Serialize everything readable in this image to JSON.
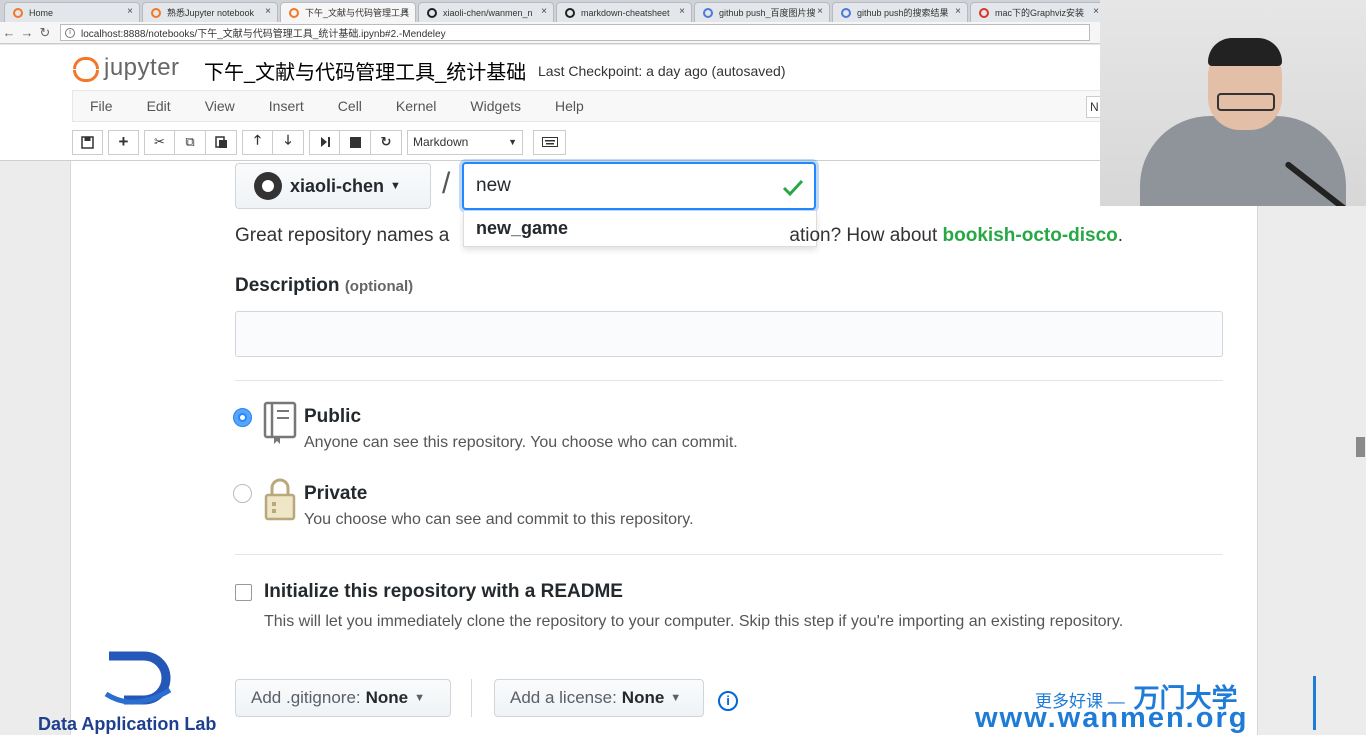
{
  "browser": {
    "tabs": [
      {
        "title": "Home",
        "color": "#f37726",
        "active": false
      },
      {
        "title": "熟悉Jupyter notebook",
        "color": "#f37726",
        "active": false
      },
      {
        "title": "下午_文献与代码管理工具",
        "color": "#f37726",
        "active": true
      },
      {
        "title": "xiaoli-chen/wanmen_n",
        "color": "#222222",
        "active": false
      },
      {
        "title": "markdown-cheatsheet",
        "color": "#222222",
        "active": false
      },
      {
        "title": "github push_百度图片搜",
        "color": "#4a7bd8",
        "active": false
      },
      {
        "title": "github push的搜索结果",
        "color": "#4a7bd8",
        "active": false
      },
      {
        "title": "mac下的Graphviz安装",
        "color": "#d9342b",
        "active": false
      }
    ],
    "url": "localhost:8888/notebooks/下午_文献与代码管理工具_统计基础.ipynb#2.-Mendeley"
  },
  "jupyter": {
    "logo_text": "jupyter",
    "notebook_title": "下午_文献与代码管理工具_统计基础",
    "checkpoint": "Last Checkpoint: a day ago (autosaved)",
    "menu": [
      "File",
      "Edit",
      "View",
      "Insert",
      "Cell",
      "Kernel",
      "Widgets",
      "Help"
    ],
    "menu_right": "N",
    "cell_type": "Markdown"
  },
  "github": {
    "owner": "xiaoli-chen",
    "repo_name": "new",
    "suggestion": "new_game",
    "great_names_start": "Great repository names a",
    "great_names_end": "ation? How about ",
    "suggested_name": "bookish-octo-disco",
    "description_label": "Description",
    "description_optional": "(optional)",
    "public_title": "Public",
    "public_desc": "Anyone can see this repository. You choose who can commit.",
    "private_title": "Private",
    "private_desc": "You choose who can see and commit to this repository.",
    "readme_title": "Initialize this repository with a README",
    "readme_desc": "This will let you immediately clone the repository to your computer. Skip this step if you're importing an existing repository.",
    "gitignore_label": "Add .gitignore:",
    "gitignore_value": "None",
    "license_label": "Add a license:",
    "license_value": "None"
  },
  "watermark": {
    "lab_name": "Data Application Lab",
    "promo_text": "更多好课 —",
    "promo_brand": "万门大学",
    "promo_url": "www.wanmen.org"
  }
}
